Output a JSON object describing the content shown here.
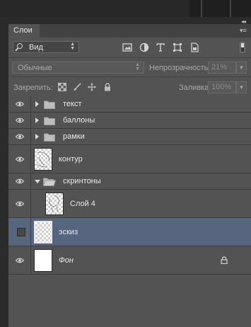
{
  "panel": {
    "tab_label": "Слои",
    "collapse_glyph": "◂◂",
    "menu_glyph": "▾≡"
  },
  "filter": {
    "kind_label": "Вид",
    "icons": [
      "image-filter-icon",
      "adjustment-filter-icon",
      "type-filter-icon",
      "shape-filter-icon",
      "smart-object-filter-icon",
      "filter-toggle-icon"
    ]
  },
  "blend": {
    "mode": "Обычные",
    "opacity_label": "Непрозрачность:",
    "opacity_value": "21%"
  },
  "lock": {
    "label": "Закрепить:",
    "icons": [
      "lock-transparent-pixels-icon",
      "lock-image-pixels-icon",
      "lock-position-icon",
      "lock-all-icon"
    ],
    "fill_label": "Заливка:",
    "fill_value": "100%"
  },
  "layers": [
    {
      "name": "текст",
      "type": "group",
      "expanded": false,
      "visible": true
    },
    {
      "name": "баллоны",
      "type": "group",
      "expanded": false,
      "visible": true
    },
    {
      "name": "рамки",
      "type": "group",
      "expanded": false,
      "visible": true
    },
    {
      "name": "контур",
      "type": "layer",
      "thumbnail": "transparent-sketch",
      "visible": true
    },
    {
      "name": "скринтоны",
      "type": "group",
      "expanded": true,
      "visible": true
    },
    {
      "name": "Слой 4",
      "type": "layer",
      "thumbnail": "transparent-sketch",
      "visible": true,
      "nested": true
    },
    {
      "name": "эскиз",
      "type": "layer",
      "thumbnail": "transparent",
      "visible": false,
      "selected": true
    },
    {
      "name": "Фон",
      "type": "background",
      "thumbnail": "white",
      "visible": true,
      "locked": true
    }
  ],
  "colors": {
    "panel_bg": "#535353",
    "selected_row": "#56667e",
    "app_bg": "#2b2b2b"
  }
}
